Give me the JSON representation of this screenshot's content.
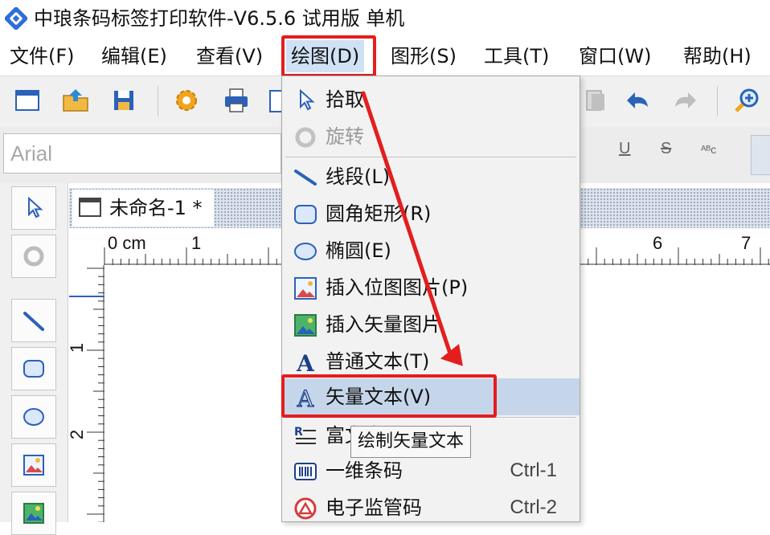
{
  "window": {
    "title": "中琅条码标签打印软件-V6.5.6 试用版 单机"
  },
  "menubar": {
    "items": [
      {
        "label": "文件(F)"
      },
      {
        "label": "编辑(E)"
      },
      {
        "label": "查看(V)"
      },
      {
        "label": "绘图(D)"
      },
      {
        "label": "图形(S)"
      },
      {
        "label": "工具(T)"
      },
      {
        "label": "窗口(W)"
      },
      {
        "label": "帮助(H)"
      }
    ]
  },
  "formatbar": {
    "font_name": "Arial",
    "underline_label": "U",
    "strike_label": "S",
    "sub_label": "ᴬᴮᴄ"
  },
  "document": {
    "tab_title": "未命名-1 *",
    "ruler_unit": "0 cm",
    "ruler_top_ticks": [
      "1",
      "6",
      "7"
    ],
    "ruler_left_ticks": [
      "1",
      "2"
    ]
  },
  "draw_menu": {
    "items": [
      {
        "label": "拾取",
        "icon": "pointer-icon",
        "shortcut": ""
      },
      {
        "label": "旋转",
        "icon": "rotate-icon",
        "shortcut": "",
        "disabled": true
      },
      {
        "label": "线段(L)",
        "icon": "line-icon",
        "shortcut": ""
      },
      {
        "label": "圆角矩形(R)",
        "icon": "rounded-rect-icon",
        "shortcut": ""
      },
      {
        "label": "椭圆(E)",
        "icon": "ellipse-icon",
        "shortcut": ""
      },
      {
        "label": "插入位图图片(P)",
        "icon": "bitmap-image-icon",
        "shortcut": ""
      },
      {
        "label": "插入矢量图片",
        "icon": "vector-image-icon",
        "shortcut": ""
      },
      {
        "label": "普通文本(T)",
        "icon": "text-icon",
        "shortcut": ""
      },
      {
        "label": "矢量文本(V)",
        "icon": "vector-text-icon",
        "shortcut": "",
        "hover": true
      },
      {
        "label": "富文本",
        "icon": "rich-text-icon",
        "shortcut": ""
      },
      {
        "label": "一维条码",
        "icon": "barcode-icon",
        "shortcut": "Ctrl-1"
      },
      {
        "label": "电子监管码",
        "icon": "supervision-code-icon",
        "shortcut": "Ctrl-2"
      }
    ]
  },
  "tooltip": {
    "text": "绘制矢量文本"
  },
  "colors": {
    "annotation_red": "#e41d1d",
    "menu_hover": "#c6d6ea",
    "selection_line": "#2f5fc0"
  }
}
